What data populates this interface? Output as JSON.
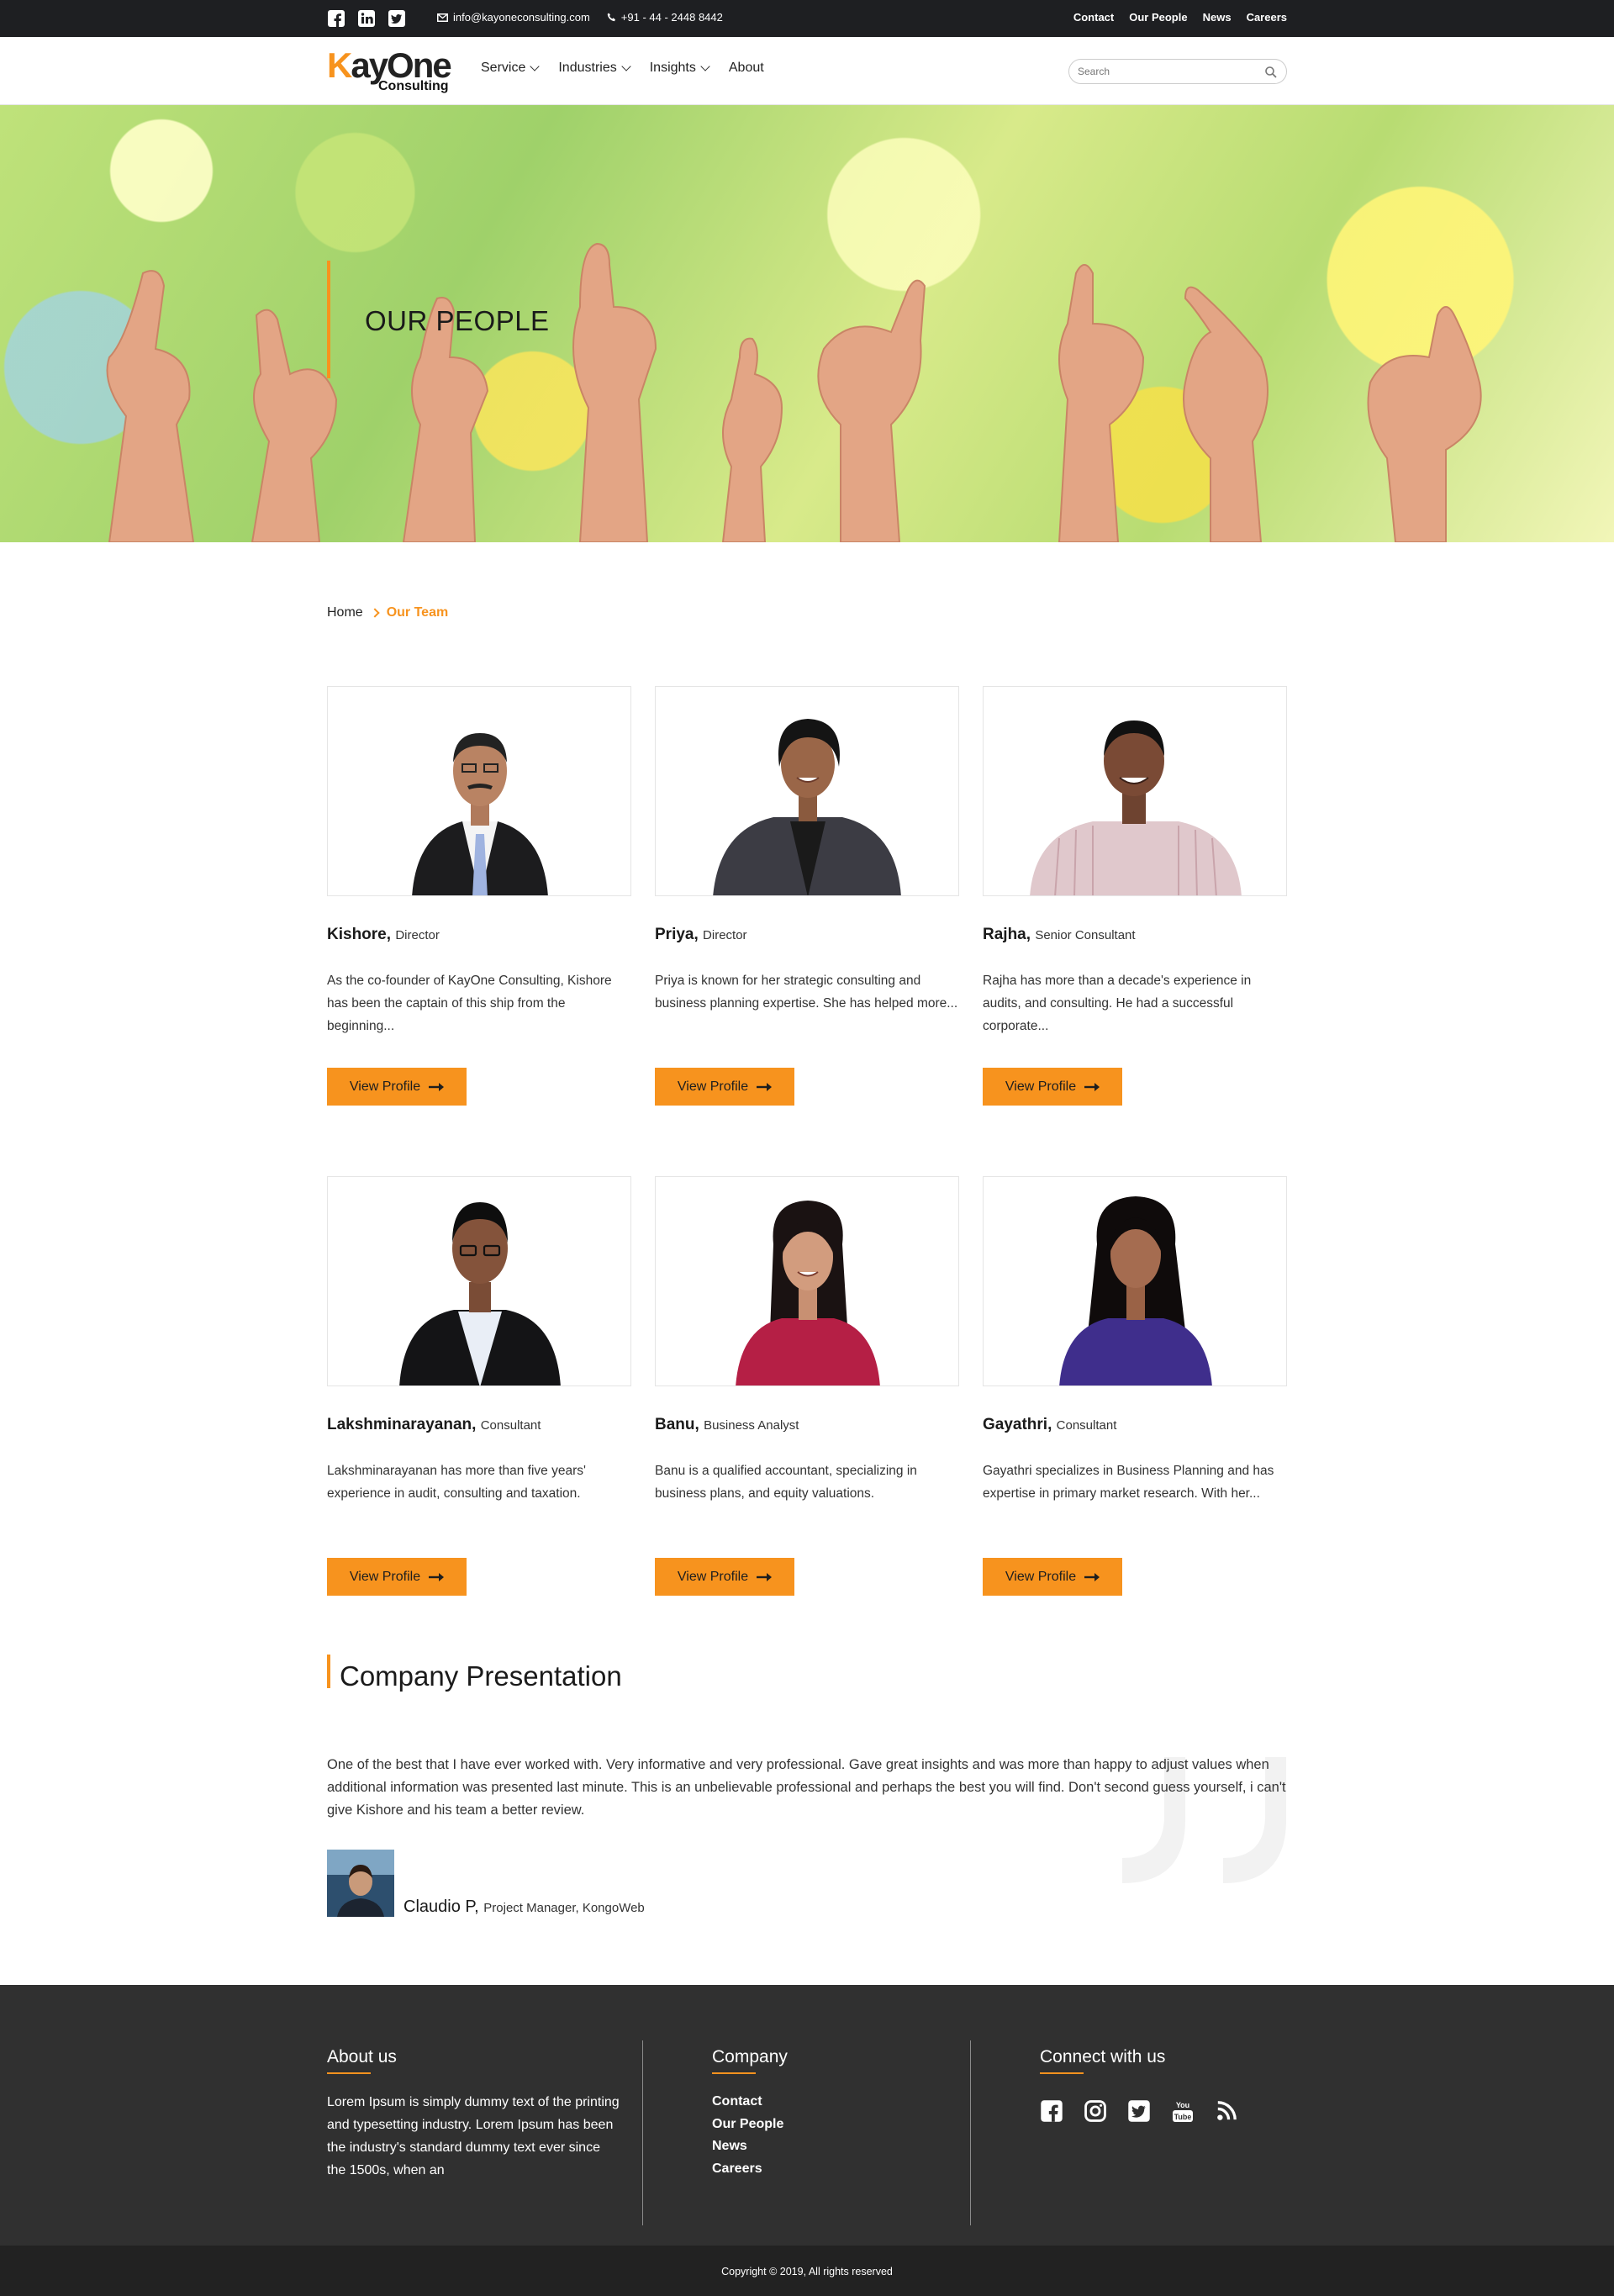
{
  "topbar": {
    "email": "info@kayoneconsulting.com",
    "phone": "+91 - 44 - 2448 8442",
    "links": [
      "Contact",
      "Our People",
      "News",
      "Careers"
    ]
  },
  "nav": {
    "logo_main": "ayOne",
    "logo_k": "K",
    "logo_sub": "Consulting",
    "menu": [
      {
        "label": "Service"
      },
      {
        "label": "Industries"
      },
      {
        "label": "Insights"
      },
      {
        "label": "About"
      }
    ],
    "search_placeholder": "Search"
  },
  "hero": {
    "title": "OUR PEOPLE"
  },
  "breadcrumb": {
    "home": "Home",
    "current": "Our Team"
  },
  "team": [
    {
      "name": "Kishore,",
      "role": "Director",
      "desc": "As the co-founder of KayOne Consulting, Kishore has been the captain of this ship from the beginning...",
      "button": "View Profile"
    },
    {
      "name": "Priya,",
      "role": "Director",
      "desc": "Priya is known for her strategic consulting and business planning expertise. She has helped more...",
      "button": "View Profile"
    },
    {
      "name": "Rajha,",
      "role": "Senior Consultant",
      "desc": "Rajha has more than a decade's experience in audits, and consulting. He had a successful corporate...",
      "button": "View Profile"
    },
    {
      "name": "Lakshminarayanan,",
      "role": "Consultant",
      "desc": "Lakshminarayanan has more than five years' experience in audit, consulting and taxation.",
      "button": "View Profile"
    },
    {
      "name": "Banu,",
      "role": "Business Analyst",
      "desc": "Banu is a qualified accountant, specializing in business plans, and equity valuations.",
      "button": "View Profile"
    },
    {
      "name": "Gayathri,",
      "role": "Consultant",
      "desc": "Gayathri specializes in Business Planning and has expertise in primary market research. With her...",
      "button": "View Profile"
    }
  ],
  "presentation": {
    "title": "Company Presentation",
    "quote": "One of the best that I have ever worked with. Very informative and very professional. Gave great insights and was more than happy to adjust values when additional information was presented last minute. This is an unbelievable professional and perhaps the best you will find. Don't second guess yourself, i can't give Kishore and his team a better review.",
    "reviewer_name": "Claudio P,",
    "reviewer_role": "Project Manager, KongoWeb"
  },
  "footer": {
    "about_title": "About us",
    "about_text": "Lorem Ipsum is simply dummy text of the printing and typesetting industry. Lorem Ipsum has been the industry's standard dummy text ever since the 1500s, when an",
    "company_title": "Company",
    "company_links": [
      "Contact",
      "Our People",
      "News",
      "Careers"
    ],
    "connect_title": "Connect with us",
    "youtube_text": "You Tube",
    "copyright": "Copyright © 2019, All rights reserved"
  },
  "colors": {
    "accent": "#f7931e",
    "topbar": "#1e1f22",
    "footer": "#303030",
    "copybar": "#222222"
  }
}
